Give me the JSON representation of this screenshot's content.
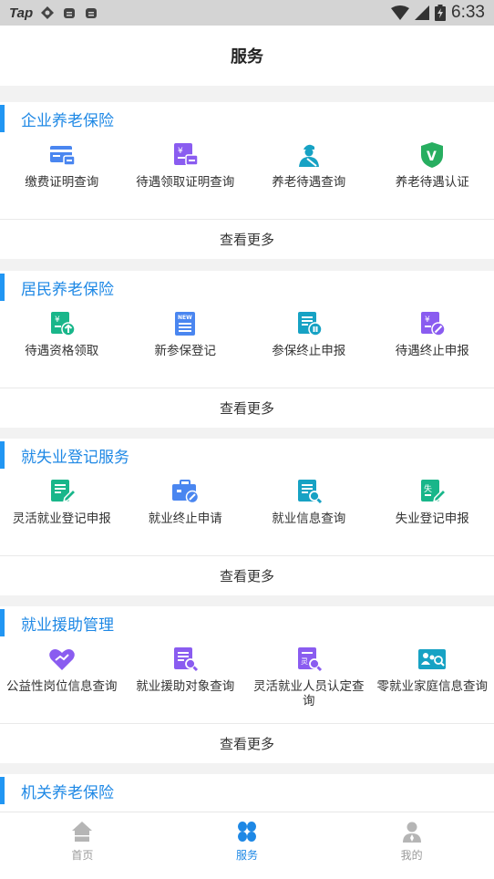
{
  "status_bar": {
    "carrier": "Tap",
    "time": "6:33"
  },
  "header": {
    "title": "服务"
  },
  "colors": {
    "accent": "#1e88e5",
    "green": "#19b68a",
    "purple": "#8a5cf0",
    "blue": "#4a86f0",
    "teal": "#17a2c4",
    "shield": "#27ae60"
  },
  "sections": [
    {
      "title": "企业养老保险",
      "items": [
        {
          "label": "缴费证明查询",
          "icon": "payment-card-icon"
        },
        {
          "label": "待遇领取证明查询",
          "icon": "yuan-printer-icon"
        },
        {
          "label": "养老待遇查询",
          "icon": "worker-icon"
        },
        {
          "label": "养老待遇认证",
          "icon": "shield-v-icon"
        }
      ],
      "more": "查看更多"
    },
    {
      "title": "居民养老保险",
      "items": [
        {
          "label": "待遇资格领取",
          "icon": "yuan-upload-icon"
        },
        {
          "label": "新参保登记",
          "icon": "new-document-icon"
        },
        {
          "label": "参保终止申报",
          "icon": "document-pause-icon"
        },
        {
          "label": "待遇终止申报",
          "icon": "yuan-stop-icon"
        }
      ],
      "more": "查看更多"
    },
    {
      "title": "就失业登记服务",
      "items": [
        {
          "label": "灵活就业登记申报",
          "icon": "document-edit-icon"
        },
        {
          "label": "就业终止申请",
          "icon": "briefcase-stop-icon"
        },
        {
          "label": "就业信息查询",
          "icon": "document-search-icon"
        },
        {
          "label": "失业登记申报",
          "icon": "unemployment-edit-icon"
        }
      ],
      "more": "查看更多"
    },
    {
      "title": "就业援助管理",
      "items": [
        {
          "label": "公益性岗位信息查询",
          "icon": "heart-hand-icon"
        },
        {
          "label": "就业援助对象查询",
          "icon": "document-search-icon"
        },
        {
          "label": "灵活就业人员认定查询",
          "icon": "ling-document-search-icon"
        },
        {
          "label": "零就业家庭信息查询",
          "icon": "family-search-icon"
        }
      ],
      "more": "查看更多"
    },
    {
      "title": "机关养老保险",
      "items": [],
      "more": ""
    }
  ],
  "bottom_nav": [
    {
      "label": "首页",
      "icon": "home-icon",
      "active": false
    },
    {
      "label": "服务",
      "icon": "grid-petals-icon",
      "active": true
    },
    {
      "label": "我的",
      "icon": "person-icon",
      "active": false
    }
  ]
}
